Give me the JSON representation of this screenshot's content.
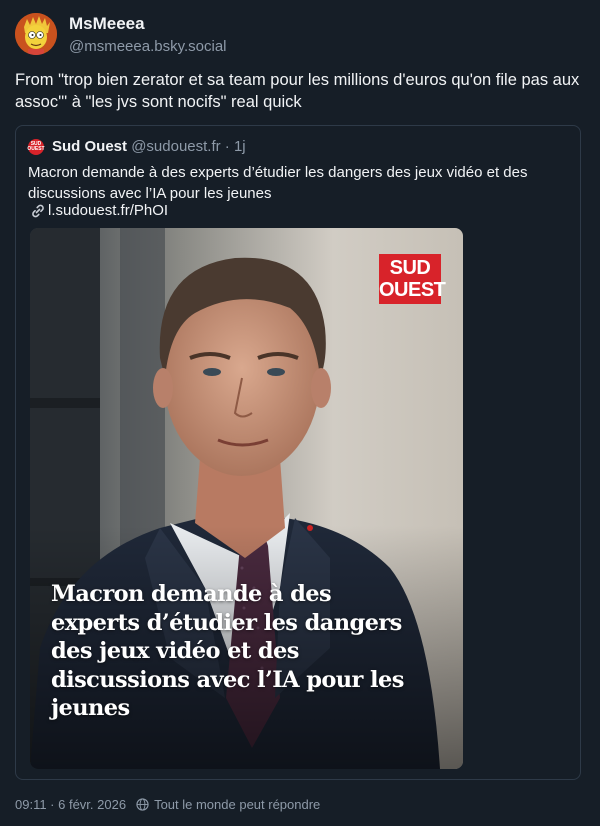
{
  "post": {
    "author_name": "MsMeeea",
    "author_handle": "@msmeeea.bsky.social",
    "text": "From \"trop bien zerator et sa team pour les millions d'euros qu'on file pas aux assoc'\" à \"les jvs sont nocifs\" real quick",
    "timestamp": "09:11 · 6 févr. 2026",
    "reply_setting": "Tout le monde peut répondre"
  },
  "quote": {
    "logo_text": "SUD OUEST",
    "author_name": "Sud Ouest",
    "author_handle": "@sudouest.fr",
    "separator": "·",
    "time": "1j",
    "text": "Macron demande à des experts d’étudier les dangers des jeux vidéo et des discussions avec l’IA pour les jeunes",
    "link": "l.sudouest.fr/PhOI",
    "image": {
      "brand_line1": "SUD",
      "brand_line2": "OUEST",
      "headline": "Macron demande à des experts d’étudier les dangers des jeux vidéo et des discussions avec l’IA pour les jeunes"
    }
  },
  "colors": {
    "background": "#161e27",
    "muted_text": "#8e9aa8",
    "border": "#2e3a48",
    "brand_red": "#d8232a"
  },
  "icons": [
    "avatar-character",
    "sud-ouest-logo",
    "link-icon",
    "globe-icon"
  ]
}
